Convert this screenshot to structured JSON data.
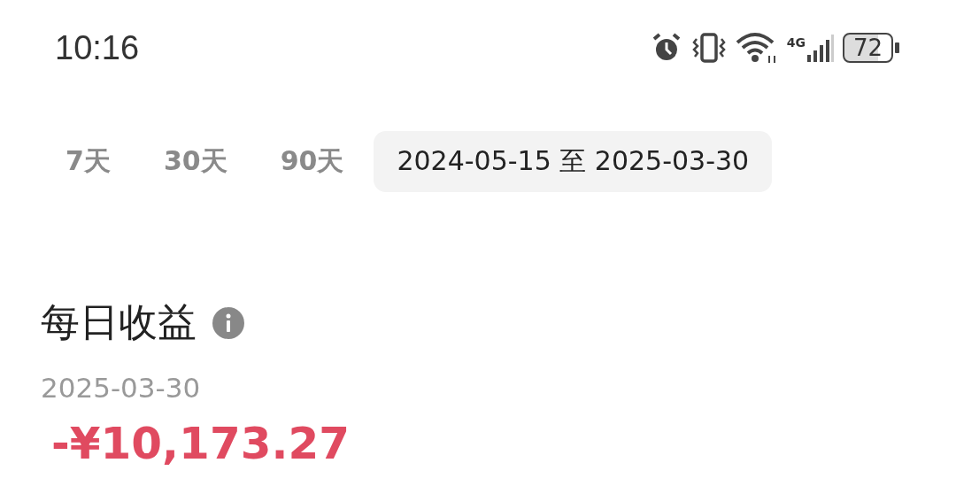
{
  "status_bar": {
    "time": "10:16",
    "network": "4G",
    "battery": "72"
  },
  "tabs": [
    {
      "label": "7天",
      "selected": false
    },
    {
      "label": "30天",
      "selected": false
    },
    {
      "label": "90天",
      "selected": false
    },
    {
      "label": "2024-05-15 至 2025-03-30",
      "selected": true
    }
  ],
  "section": {
    "title": "每日收益",
    "date": "2025-03-30",
    "amount": "-¥10,173.27"
  }
}
